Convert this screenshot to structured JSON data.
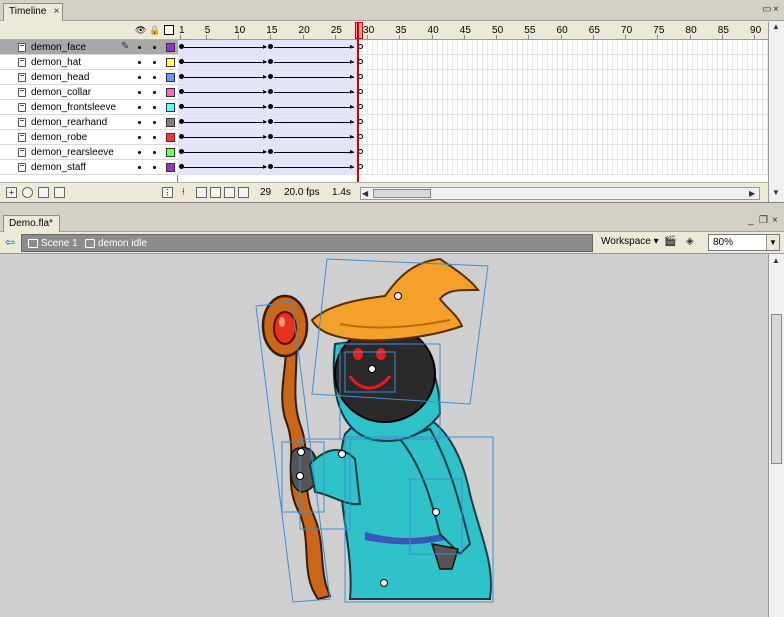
{
  "timeline": {
    "tab_title": "Timeline",
    "close_glyph": "×",
    "header_icons": [
      "eye-icon",
      "lock-icon",
      "outline-icon"
    ],
    "layers": [
      {
        "name": "demon_face",
        "color": "#9933cc",
        "selected": true
      },
      {
        "name": "demon_hat",
        "color": "#ffff66"
      },
      {
        "name": "demon_head",
        "color": "#6699ff"
      },
      {
        "name": "demon_collar",
        "color": "#ff66cc"
      },
      {
        "name": "demon_frontsleeve",
        "color": "#66ffff"
      },
      {
        "name": "demon_rearhand",
        "color": "#808080"
      },
      {
        "name": "demon_robe",
        "color": "#ff3333"
      },
      {
        "name": "demon_rearsleeve",
        "color": "#66ff66"
      },
      {
        "name": "demon_staff",
        "color": "#9933cc"
      }
    ],
    "ruler_labels": [
      "1",
      "5",
      "10",
      "15",
      "20",
      "25",
      "30",
      "35",
      "40",
      "45",
      "50",
      "55",
      "60",
      "65",
      "70",
      "75",
      "80",
      "85",
      "90"
    ],
    "current_frame": "29",
    "fps": "20.0 fps",
    "elapsed": "1.4s"
  },
  "document": {
    "tab_title": "Demo.fla*",
    "breadcrumbs": [
      {
        "label": "Scene 1",
        "icon": "scene-icon"
      },
      {
        "label": "demon idle",
        "icon": "symbol-icon"
      }
    ],
    "workspace_label": "Workspace ▾",
    "zoom_value": "80%"
  },
  "colors": {
    "hat": "#f3a12a",
    "robe": "#2fc2c9",
    "staff": "#c8661a",
    "gem": "#e8311c",
    "bbox": "#3c8fd6"
  }
}
